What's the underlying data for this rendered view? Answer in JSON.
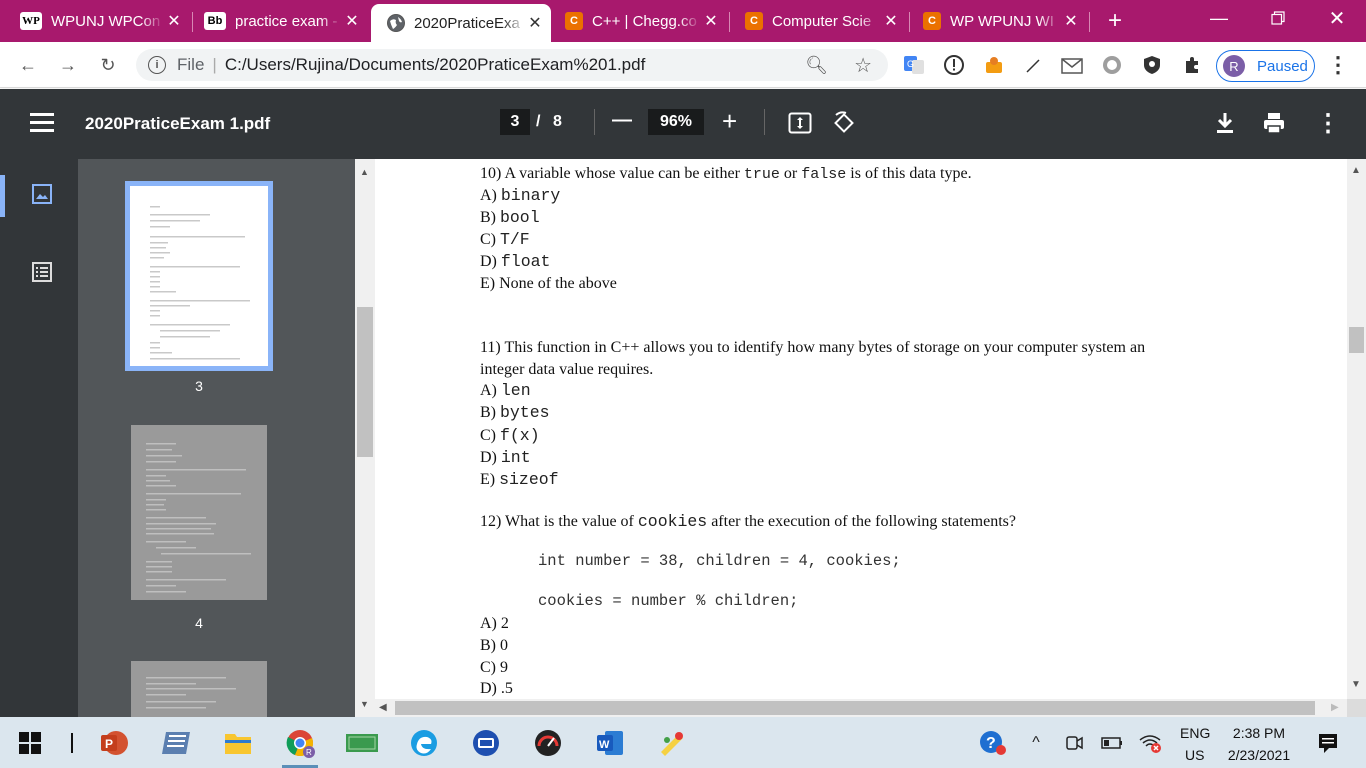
{
  "tabs": [
    {
      "label": "WPUNJ WPCon",
      "favicon": "WP"
    },
    {
      "label": "practice exam -",
      "favicon": "Bb"
    },
    {
      "label": "2020PraticeExa",
      "favicon": "globe",
      "active": true
    },
    {
      "label": "C++ | Chegg.co",
      "favicon": "C"
    },
    {
      "label": "Computer Scie",
      "favicon": "C"
    },
    {
      "label": "WP WPUNJ WI",
      "favicon": "C"
    }
  ],
  "new_tab": "+",
  "address": {
    "scheme_label": "File",
    "url": "C:/Users/Rujina/Documents/2020PraticeExam%201.pdf"
  },
  "profile": {
    "initial": "R",
    "status": "Paused"
  },
  "pdf": {
    "title": "2020PraticeExam 1.pdf",
    "current_page": "3",
    "page_separator": "/",
    "total_pages": "8",
    "zoom": "96%",
    "zoom_out": "—",
    "zoom_in": "+"
  },
  "thumbnails": [
    {
      "label": "3",
      "selected": true
    },
    {
      "label": "4",
      "selected": false
    },
    {
      "label": "",
      "selected": false
    }
  ],
  "questions": {
    "q10": {
      "stem_a": "10) A variable whose value can be either ",
      "true_kw": "true",
      "stem_b": " or ",
      "false_kw": "false",
      "stem_c": " is of this data type.",
      "options": [
        {
          "letter": "A) ",
          "text": "binary"
        },
        {
          "letter": "B) ",
          "text": "bool"
        },
        {
          "letter": "C) ",
          "text": "T/F"
        },
        {
          "letter": "D) ",
          "text": "float"
        },
        {
          "letter": "E) ",
          "text": "None of the above"
        }
      ]
    },
    "q11": {
      "line1": "11) This function in C++ allows you to identify how many bytes of storage on your computer system an",
      "line2": "integer data value requires.",
      "options": [
        {
          "letter": "A) ",
          "text": "len"
        },
        {
          "letter": "B) ",
          "text": "bytes"
        },
        {
          "letter": "C) ",
          "text": "f(x)"
        },
        {
          "letter": "D) ",
          "text": "int"
        },
        {
          "letter": "E) ",
          "text": "sizeof"
        }
      ]
    },
    "q12": {
      "stem_a": "12) What is the value of ",
      "kw": "cookies",
      "stem_b": " after the execution of the following statements?",
      "code1": "int number = 38, children = 4, cookies;",
      "code2": "cookies = number % children;",
      "options": [
        {
          "letter": "A) ",
          "text": "2"
        },
        {
          "letter": "B) ",
          "text": "0"
        },
        {
          "letter": "C) ",
          "text": "9"
        },
        {
          "letter": "D) ",
          "text": ".5"
        }
      ]
    }
  },
  "taskbar": {
    "lang_top": "ENG",
    "lang_bottom": "US",
    "time": "2:38 PM",
    "date": "2/23/2021"
  },
  "colors": {
    "tabstrip": "#a8196d",
    "pdf_toolbar": "#323639",
    "sidebar": "#525659",
    "selected_thumb": "#8ab4f8"
  }
}
